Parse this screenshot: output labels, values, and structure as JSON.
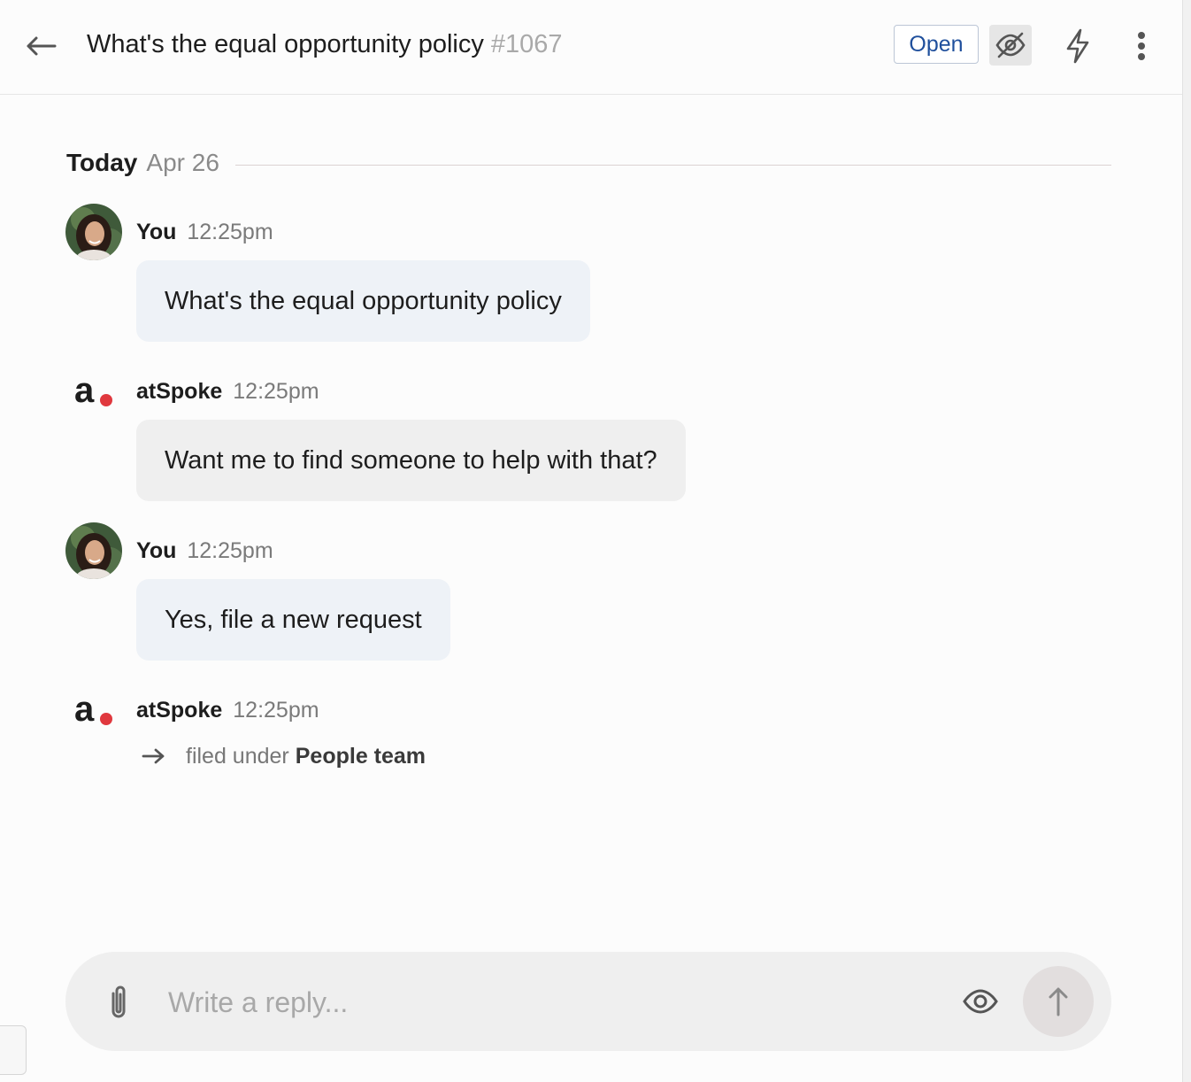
{
  "header": {
    "title": "What's the equal opportunity policy",
    "ticket_id": "#1067",
    "status_label": "Open",
    "icons": {
      "back": "arrow-left-icon",
      "hide": "eye-off-icon",
      "automation": "lightning-bolt-icon",
      "more": "more-vertical-icon"
    }
  },
  "date_divider": {
    "label": "Today",
    "date": "Apr 26"
  },
  "messages": [
    {
      "author": "You",
      "time": "12:25pm",
      "text": "What's the equal opportunity policy",
      "avatar": "user-photo"
    },
    {
      "author": "atSpoke",
      "time": "12:25pm",
      "text": "Want me to find someone to help with that?",
      "avatar": "atspoke-logo"
    },
    {
      "author": "You",
      "time": "12:25pm",
      "text": "Yes, file a new request",
      "avatar": "user-photo"
    },
    {
      "author": "atSpoke",
      "time": "12:25pm",
      "avatar": "atspoke-logo"
    }
  ],
  "event": {
    "prefix": "filed under",
    "team": "People team",
    "icon": "arrow-right-icon"
  },
  "composer": {
    "placeholder": "Write a reply...",
    "icons": {
      "attach": "paperclip-icon",
      "visibility": "eye-icon",
      "send": "arrow-up-icon"
    }
  },
  "colors": {
    "status_text": "#1f4f9c",
    "logo_dot": "#e0383e",
    "user_bubble": "#eef2f7",
    "bot_bubble": "#efefef"
  }
}
